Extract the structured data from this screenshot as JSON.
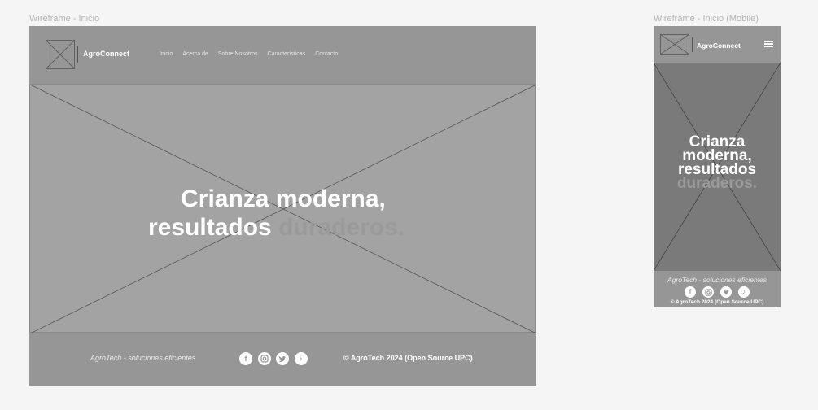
{
  "frames": {
    "desktop_label": "Wireframe - Inicio",
    "mobile_label": "Wireframe - Inicio (Mobile)"
  },
  "brand": "AgroConnect",
  "nav": {
    "items": [
      {
        "label": "Inicio"
      },
      {
        "label": "Acerca de"
      },
      {
        "label": "Sobre Nosotros"
      },
      {
        "label": "Características"
      },
      {
        "label": "Contacto"
      }
    ]
  },
  "hero": {
    "line1": "Crianza moderna,",
    "line2_main": "resultados",
    "line2_accent": "duraderos.",
    "mobile_line1": "Crianza",
    "mobile_line2": "moderna,",
    "mobile_line3": "resultados",
    "mobile_line4": "duraderos."
  },
  "footer": {
    "tagline": "AgroTech - soluciones eficientes",
    "copyright": "© AgroTech 2024 (Open Source UPC)",
    "social_icons": [
      "facebook-icon",
      "instagram-icon",
      "twitter-icon",
      "tiktok-icon"
    ]
  },
  "colors": {
    "page_bg": "#f5f5f5",
    "header_footer": "#969696",
    "hero_desktop": "#a3a3a3",
    "hero_mobile": "#7a7a7a",
    "accent_text": "#9a9a9a"
  }
}
